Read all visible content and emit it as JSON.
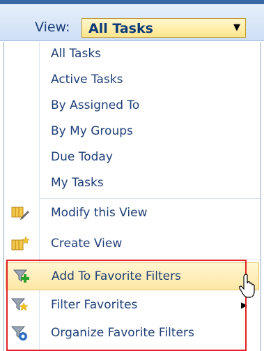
{
  "toolbar": {
    "view_label": "View:",
    "view_value": "All Tasks",
    "dropdown_arrow_icon": "caret-down-icon"
  },
  "menu": {
    "views": [
      {
        "label": "All Tasks"
      },
      {
        "label": "Active Tasks"
      },
      {
        "label": "By Assigned To"
      },
      {
        "label": "By My Groups"
      },
      {
        "label": "Due Today"
      },
      {
        "label": "My Tasks"
      }
    ],
    "actions": [
      {
        "label": "Modify this View",
        "icon": "modify-view-icon"
      },
      {
        "label": "Create View",
        "icon": "create-view-icon"
      }
    ],
    "favorites": [
      {
        "label": "Add To Favorite Filters",
        "icon": "add-filter-icon",
        "hovered": true
      },
      {
        "label": "Filter Favorites",
        "icon": "star-filter-icon",
        "submenu": true
      },
      {
        "label": "Organize Favorite Filters",
        "icon": "organize-filter-icon"
      }
    ]
  },
  "colors": {
    "accent": "#1f3f78",
    "hover": "#fde7a4",
    "annotation": "#e02424"
  }
}
